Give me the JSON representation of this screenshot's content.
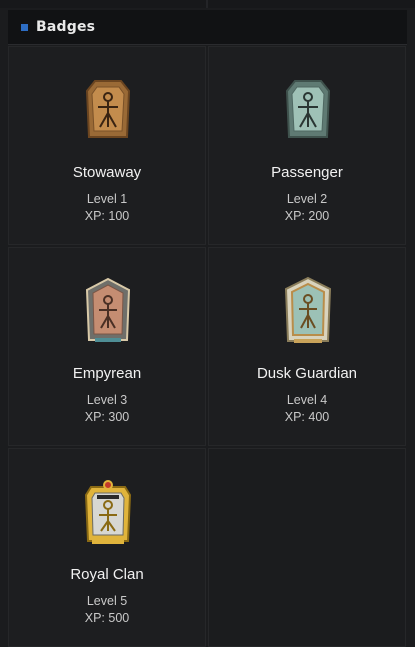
{
  "section": {
    "title": "Badges"
  },
  "badges": [
    {
      "name": "Stowaway",
      "level": "Level 1",
      "xp": "XP: 100",
      "icon": "stowaway-badge-icon",
      "color": "#b8834a"
    },
    {
      "name": "Passenger",
      "level": "Level 2",
      "xp": "XP: 200",
      "icon": "passenger-badge-icon",
      "color": "#8fb3a8"
    },
    {
      "name": "Empyrean",
      "level": "Level 3",
      "xp": "XP: 300",
      "icon": "empyrean-badge-icon",
      "color": "#c58d72"
    },
    {
      "name": "Dusk Guardian",
      "level": "Level 4",
      "xp": "XP: 400",
      "icon": "dusk-guardian-badge-icon",
      "color": "#9cc1b6"
    },
    {
      "name": "Royal Clan",
      "level": "Level 5",
      "xp": "XP: 500",
      "icon": "royal-clan-badge-icon",
      "color": "#d9b04a"
    }
  ]
}
